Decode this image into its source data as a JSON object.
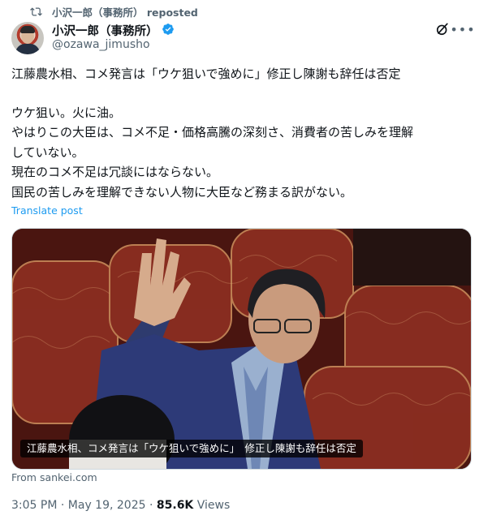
{
  "repost": {
    "icon": "repost-icon",
    "text": "小沢一郎（事務所） reposted"
  },
  "author": {
    "name": "小沢一郎（事務所）",
    "handle": "@ozawa_jimusho",
    "verified": true,
    "verified_color": "#1d9bf0"
  },
  "post": {
    "lines": [
      "江藤農水相、コメ発言は「ウケ狙いで強めに」修正し陳謝も辞任は否定",
      "",
      "ウケ狙い。火に油。",
      "やはりこの大臣は、コメ不足・価格高騰の深刻さ、消費者の苦しみを理解",
      "していない。",
      "現在のコメ不足は冗談にはならない。",
      "国民の苦しみを理解できない人物に大臣など務まる訳がない。"
    ],
    "translate_label": "Translate post"
  },
  "media": {
    "caption": "江藤農水相、コメ発言は「ウケ狙いで強めに」　修正し陳謝も辞任は否定",
    "source": "From sankei.com"
  },
  "meta": {
    "time": "3:05 PM",
    "date": "May 19, 2025",
    "views_count": "85.6K",
    "views_label": "Views"
  },
  "colors": {
    "accent": "#1d9bf0",
    "secondary_text": "#536471",
    "primary_text": "#0f1419"
  }
}
